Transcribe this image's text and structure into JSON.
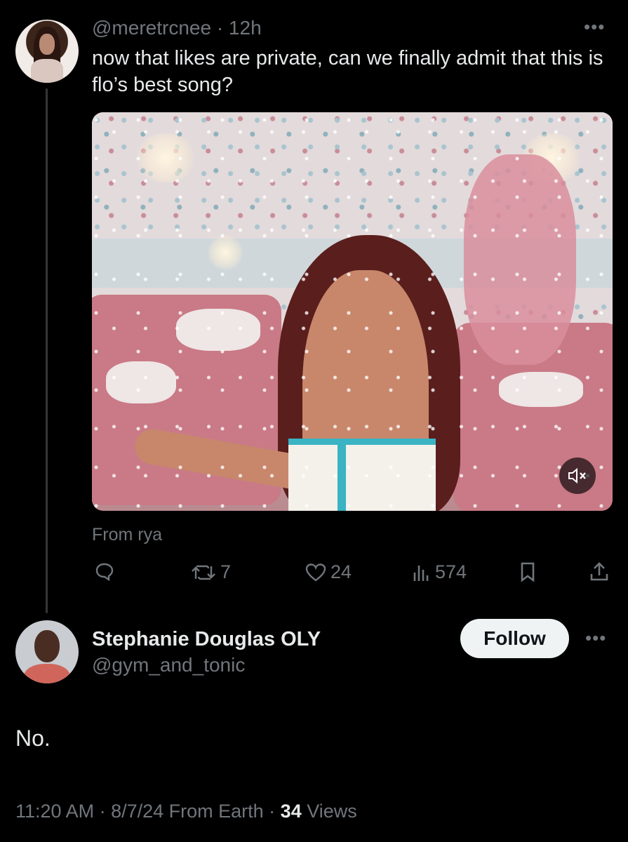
{
  "tweet": {
    "handle_time": "@meretrcnee · 12h",
    "more_icon": "more-horizontal-icon",
    "text": "now that likes are private, can we finally admit that this is flo’s best song?",
    "media_source": "From rya",
    "media_control": "mute-icon",
    "actions": {
      "reply_count": "",
      "retweet_count": "7",
      "like_count": "24",
      "views_count": "574"
    }
  },
  "reply": {
    "display_name": "Stephanie Douglas OLY",
    "handle": "@gym_and_tonic",
    "follow_label": "Follow",
    "text": "No.",
    "meta_prefix": "11:20 AM · 8/7/24 From Earth · ",
    "views_count": "34",
    "views_label": " Views"
  },
  "colors": {
    "background": "#000000",
    "text_primary": "#e7e9ea",
    "text_secondary": "#71767b",
    "follow_button_bg": "#eff3f4"
  }
}
